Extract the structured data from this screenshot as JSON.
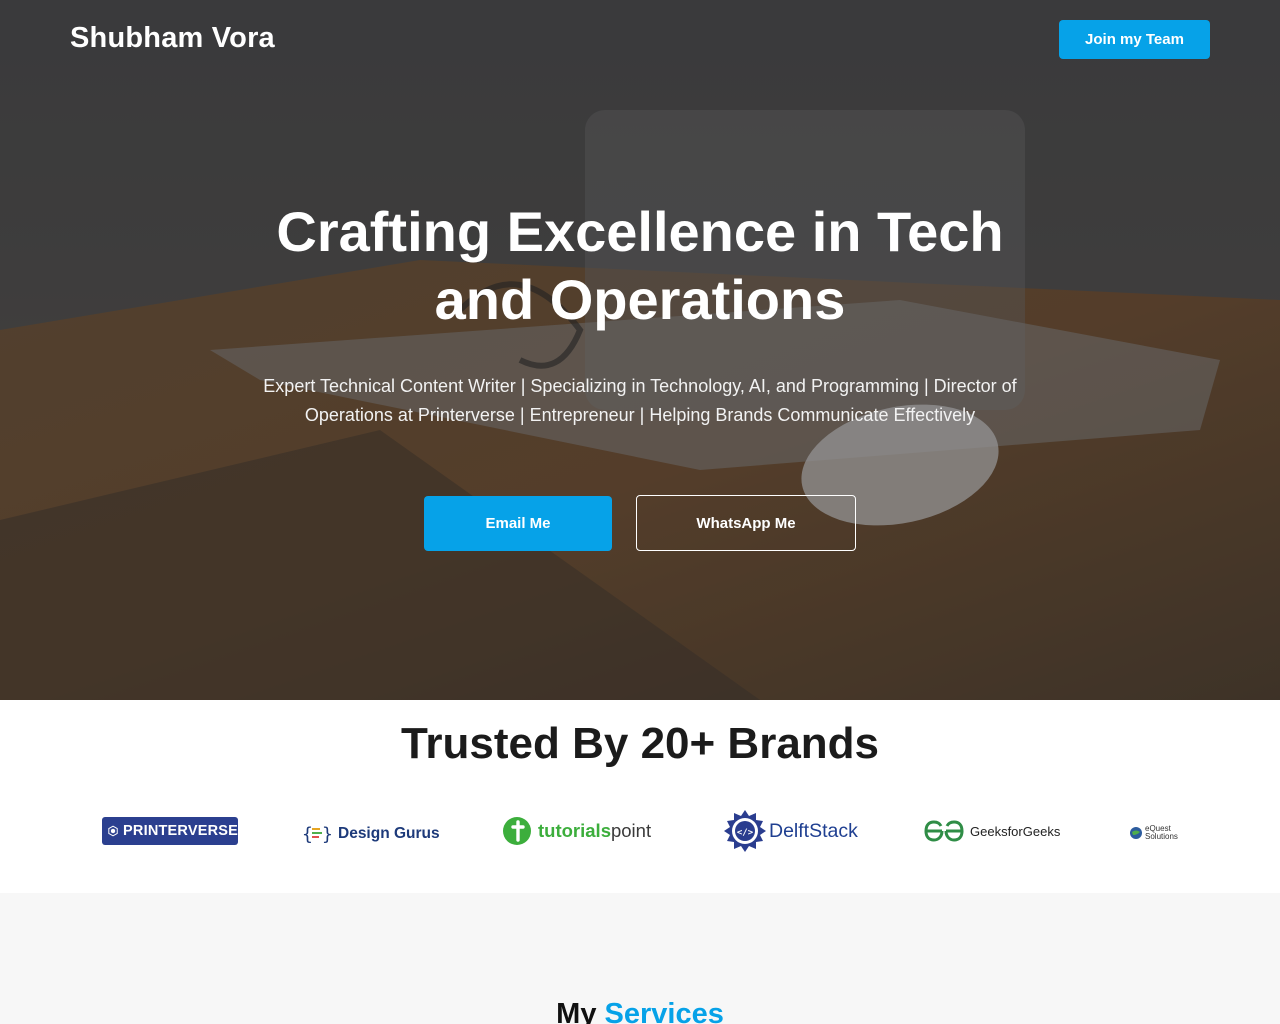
{
  "header": {
    "brand_name": "Shubham Vora",
    "cta_label": "Join my Team"
  },
  "hero": {
    "title": "Crafting Excellence in Tech and Operations",
    "subtitle": "Expert Technical Content Writer | Specializing in Technology, AI, and Programming | Director of Operations at Printerverse | Entrepreneur | Helping Brands Communicate Effectively",
    "primary_button": "Email Me",
    "secondary_button": "WhatsApp Me"
  },
  "trusted": {
    "title": "Trusted By 20+ Brands",
    "logos": {
      "printerverse": "PRINTERVERSE",
      "design_gurus": "Design Gurus",
      "tutorialspoint_a": "tutorials",
      "tutorialspoint_b": "point",
      "delftstack": "DelftStack",
      "geeksforgeeks": "GeeksforGeeks",
      "equest_line1": "eQuest",
      "equest_line2": "Solutions"
    }
  },
  "services": {
    "title_part1": "My",
    "title_part2": "Services"
  },
  "colors": {
    "accent": "#06a2e8",
    "hero_overlay": "#2a2a2a",
    "text_dark": "#1b1b1b"
  }
}
